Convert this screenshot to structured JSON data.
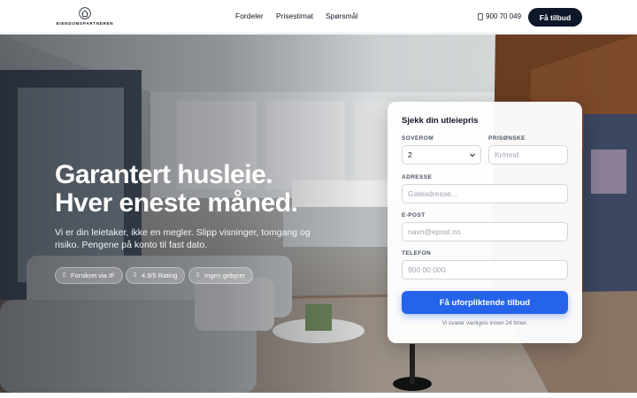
{
  "header": {
    "logo_text": "EIENDOMSPARTNEREN",
    "nav": [
      "Fordeler",
      "Prisestimat",
      "Spørsmål"
    ],
    "phone": "900 70 049",
    "cta_label": "Få tilbud"
  },
  "hero": {
    "headline_line1": "Garantert husleie.",
    "headline_line2": "Hver eneste måned.",
    "subtext": "Vi er din leietaker, ikke en megler. Slipp visninger, tomgang og risiko. Pengene på konto til fast dato.",
    "badges": [
      "Forsikret via IF",
      "4.9/5 Rating",
      "Ingen gebyrer"
    ]
  },
  "form": {
    "title": "Sjekk din utleiepris",
    "bedrooms_label": "SOVEROM",
    "bedrooms_value": "2",
    "price_label": "PRISØNSKE",
    "price_placeholder": "Kr/mnd",
    "address_label": "ADRESSE",
    "address_placeholder": "Gateadresse...",
    "email_label": "E-POST",
    "email_placeholder": "navn@epost.no",
    "phone_label": "TELEFON",
    "phone_placeholder": "900 00 000",
    "submit_label": "Få uforpliktende tilbud",
    "note": "Vi svarer vanligvis innen 24 timer."
  },
  "colors": {
    "primary": "#2563eb",
    "dark": "#0f172a"
  }
}
